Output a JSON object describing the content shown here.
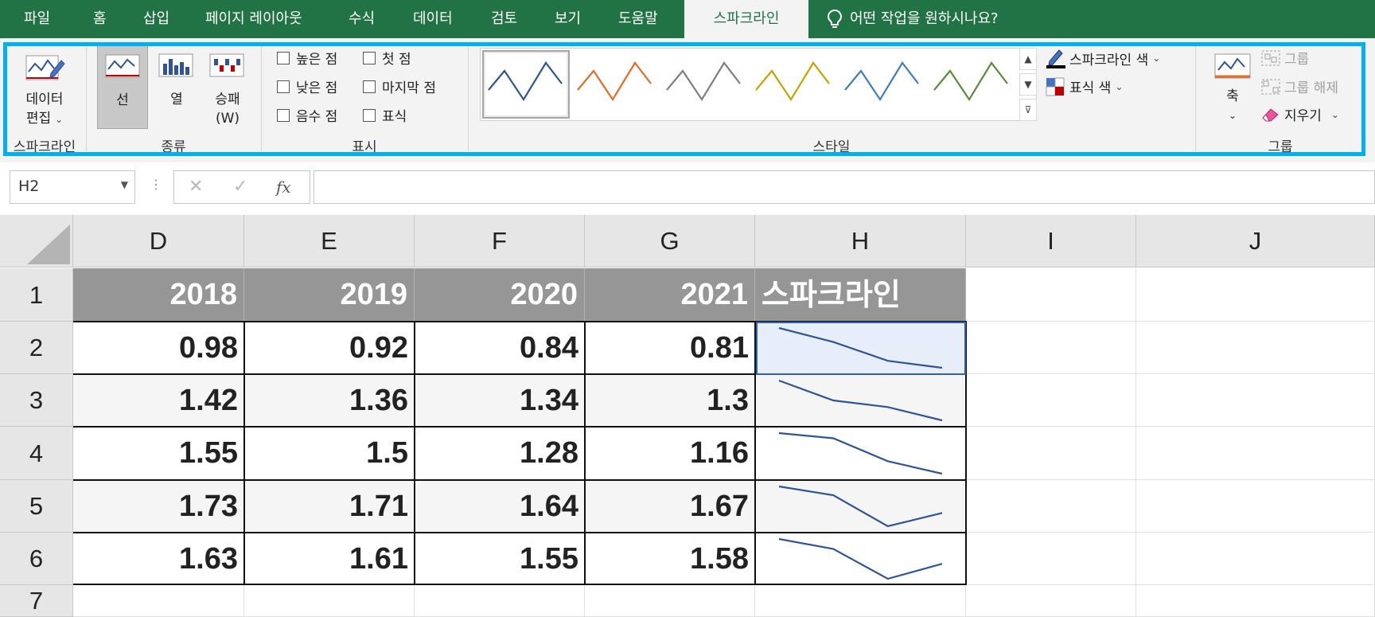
{
  "menu": {
    "tabs": [
      {
        "label": "파일"
      },
      {
        "label": "홈"
      },
      {
        "label": "삽입"
      },
      {
        "label": "페이지 레이아웃"
      },
      {
        "label": "수식"
      },
      {
        "label": "데이터"
      },
      {
        "label": "검토"
      },
      {
        "label": "보기"
      },
      {
        "label": "도움말"
      },
      {
        "label": "스파크라인"
      }
    ],
    "active_tab": "스파크라인",
    "tell_me": "어떤 작업을 원하시나요?"
  },
  "ribbon": {
    "sparkline_group": {
      "label": "스파크라인",
      "edit_data_line1": "데이터",
      "edit_data_line2": "편집"
    },
    "type_group": {
      "label": "종류",
      "line": "선",
      "column": "열",
      "winloss_line1": "승패",
      "winloss_line2": "(W)"
    },
    "show_group": {
      "label": "표시",
      "checkboxes": [
        {
          "label": "높은 점",
          "checked": false
        },
        {
          "label": "낮은 점",
          "checked": false
        },
        {
          "label": "음수 점",
          "checked": false
        },
        {
          "label": "첫 점",
          "checked": false
        },
        {
          "label": "마지막 점",
          "checked": false
        },
        {
          "label": "표식",
          "checked": false
        }
      ]
    },
    "style_group": {
      "label": "스타일",
      "swatch_colors": [
        "#2f5597",
        "#e46c23",
        "#7f7f7f",
        "#c9a200",
        "#3d7dc6",
        "#5b8c3a"
      ],
      "sparkline_color": "스파크라인 색",
      "marker_color": "표식 색"
    },
    "group_group": {
      "label": "그룹",
      "axis": "축",
      "group": "그룹",
      "ungroup": "그룹 해제",
      "clear": "지우기"
    }
  },
  "formula_bar": {
    "name_box": "H2",
    "cancel": "✕",
    "enter": "✓",
    "fx": "fx",
    "formula": ""
  },
  "sheet": {
    "columns": [
      "D",
      "E",
      "F",
      "G",
      "H",
      "I",
      "J"
    ],
    "rows": [
      "1",
      "2",
      "3",
      "4",
      "5",
      "6",
      "7"
    ],
    "header_row": [
      "2018",
      "2019",
      "2020",
      "2021",
      "스파크라인"
    ],
    "data": [
      [
        "0.98",
        "0.92",
        "0.84",
        "0.81"
      ],
      [
        "1.42",
        "1.36",
        "1.34",
        "1.3"
      ],
      [
        "1.55",
        "1.5",
        "1.28",
        "1.16"
      ],
      [
        "1.73",
        "1.71",
        "1.64",
        "1.67"
      ],
      [
        "1.63",
        "1.61",
        "1.55",
        "1.58"
      ]
    ],
    "sparkline_color": "#2f5597",
    "selected_cell": "H2"
  }
}
